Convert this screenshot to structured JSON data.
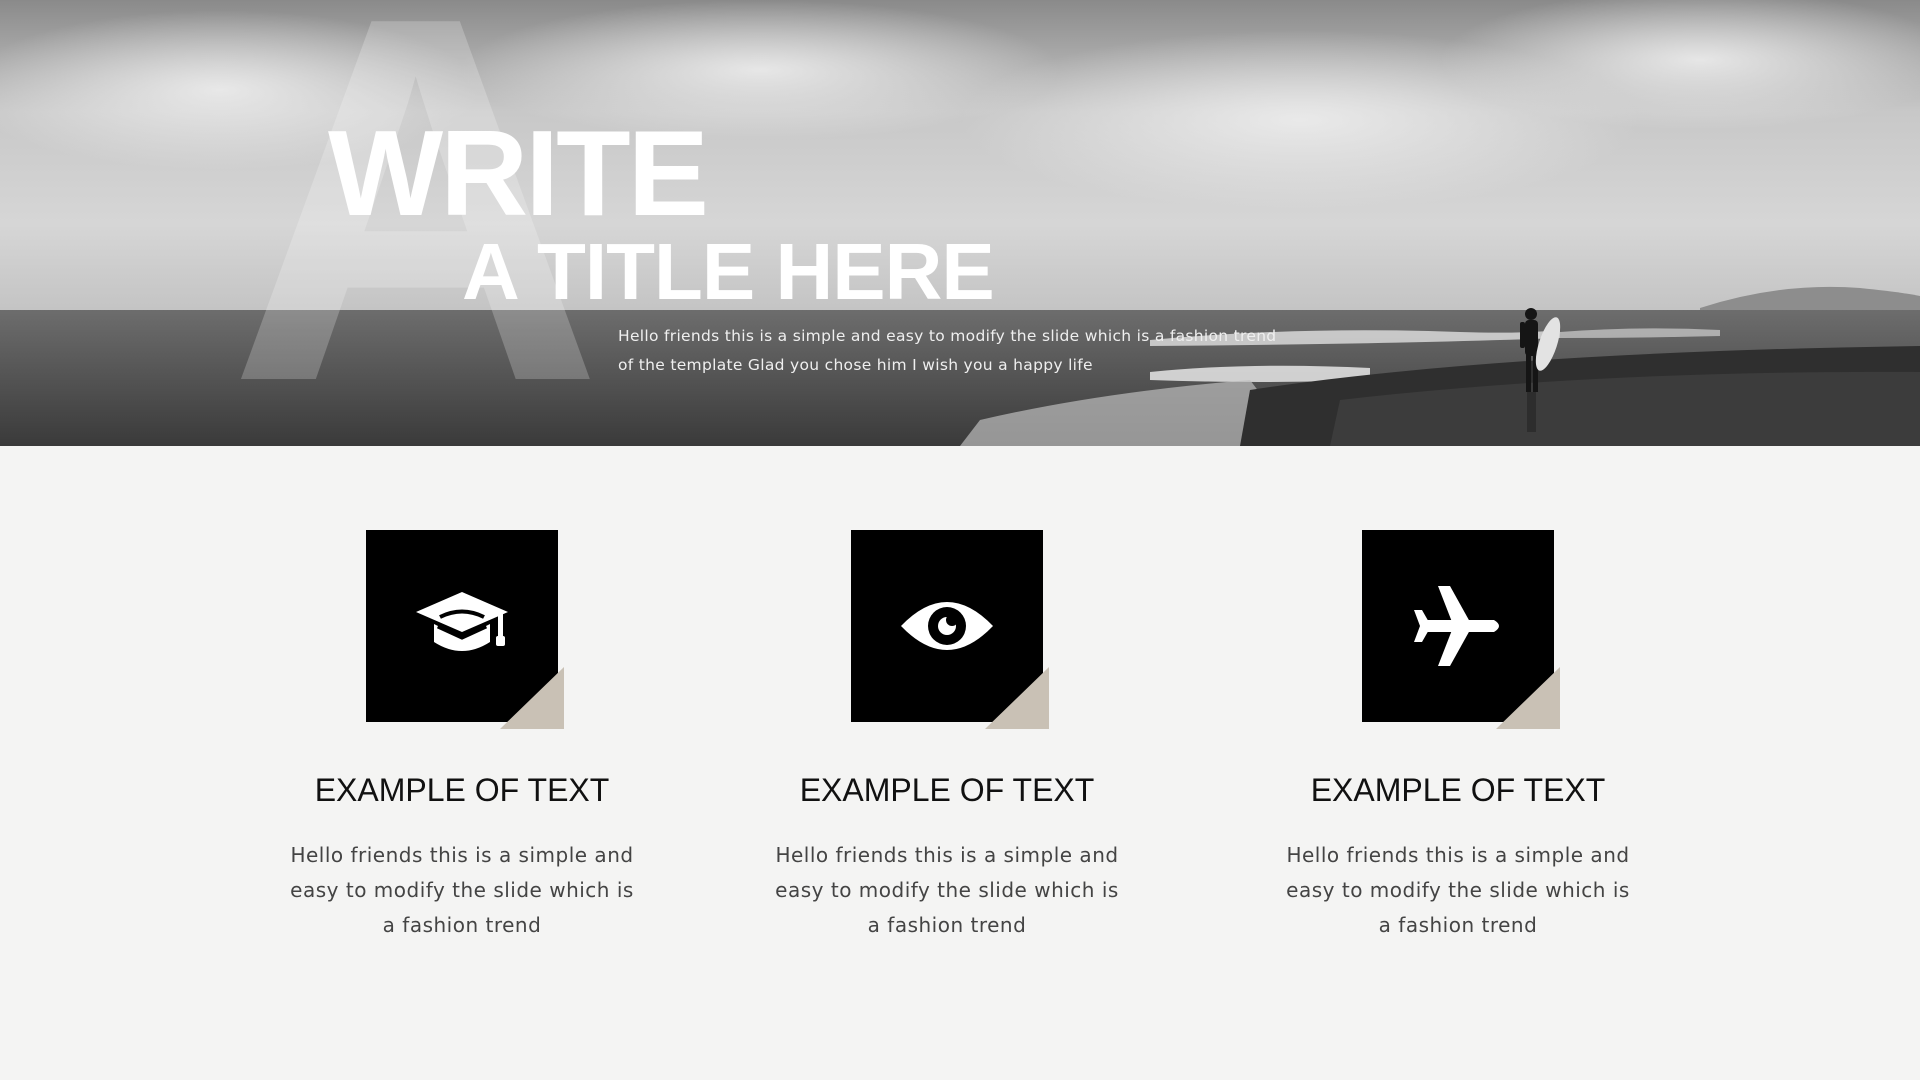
{
  "hero": {
    "big_letter": "A",
    "title_line1": "WRITE",
    "title_line2": "A TITLE HERE",
    "description": "Hello friends this is a simple and easy to modify the slide which is a fashion trend of the template Glad you chose him I wish you a happy life"
  },
  "features": [
    {
      "icon": "graduation-cap-icon",
      "title": "EXAMPLE OF TEXT",
      "text": "Hello friends this is a simple and easy to modify the slide which is a fashion trend"
    },
    {
      "icon": "eye-icon",
      "title": "EXAMPLE OF TEXT",
      "text": "Hello friends this is a simple and easy to modify the slide which is a fashion trend"
    },
    {
      "icon": "airplane-icon",
      "title": "EXAMPLE OF TEXT",
      "text": "Hello friends this is a simple and easy to modify the slide which is a fashion trend"
    }
  ],
  "colors": {
    "background": "#f4f4f3",
    "icon_box": "#000000",
    "fold_accent": "#c9c1b5",
    "title_text": "#111111",
    "body_text": "#444444"
  }
}
